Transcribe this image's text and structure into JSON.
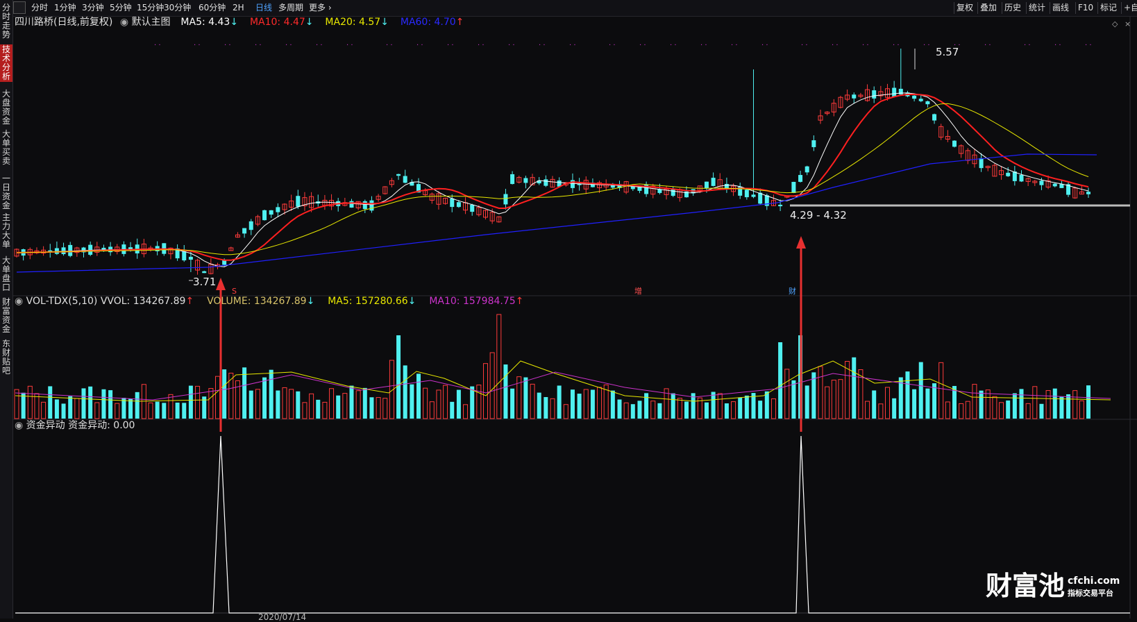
{
  "sidebar": {
    "tabs": [
      {
        "label": "分时走势",
        "active": false
      },
      {
        "label": "技术分析",
        "active": true
      },
      {
        "label": "大盘资金",
        "active": false
      },
      {
        "label": "大单买卖",
        "active": false
      },
      {
        "label": "一日资金",
        "active": false
      },
      {
        "label": "主力大单",
        "active": false
      },
      {
        "label": "大单盘口",
        "active": false
      },
      {
        "label": "财富资金",
        "active": false
      },
      {
        "label": "东财贴吧",
        "active": false
      }
    ]
  },
  "toolbar": {
    "periods": [
      {
        "label": "分时",
        "active": false
      },
      {
        "label": "1分钟",
        "active": false
      },
      {
        "label": "3分钟",
        "active": false
      },
      {
        "label": "5分钟",
        "active": false
      },
      {
        "label": "15分钟",
        "active": false
      },
      {
        "label": "30分钟",
        "active": false
      },
      {
        "label": "60分钟",
        "active": false
      },
      {
        "label": "2H",
        "active": false
      },
      {
        "label": "日线",
        "active": true
      },
      {
        "label": "多周期",
        "active": false
      },
      {
        "label": "更多",
        "active": false
      }
    ],
    "right": [
      "复权",
      "叠加",
      "历史",
      "统计",
      "画线",
      "F10",
      "标记",
      "+自"
    ]
  },
  "main_legend": {
    "stock": "四川路桥(日线,前复权)",
    "indicator": "默认主图",
    "ma5": "MA5: 4.43",
    "ma5_arrow": "↓",
    "ma10": "MA10: 4.47",
    "ma10_arrow": "↓",
    "ma20": "MA20: 4.57",
    "ma20_arrow": "↓",
    "ma60": "MA60: 4.70",
    "ma60_arrow": "↑"
  },
  "vol_legend": {
    "name": "VOL-TDX(5,10)",
    "vvol": "VVOL: 134267.89",
    "vvol_arrow": "↑",
    "volume": "VOLUME: 134267.89",
    "volume_arrow": "↓",
    "ma5": "MA5: 157280.66",
    "ma5_arrow": "↓",
    "ma10": "MA10: 157984.75",
    "ma10_arrow": "↑"
  },
  "fund_legend": {
    "name": "资金异动",
    "value": "资金异动: 0.00"
  },
  "annotations": {
    "high_label": "5.57",
    "low_label": "3.71",
    "range_label": "4.29 - 4.32",
    "marker_s": "S",
    "marker_zeng": "增",
    "marker_cai": "财"
  },
  "date_labels": [
    "2020/07/14"
  ],
  "watermark": {
    "brand": "财富池",
    "domain": "cfchi.com",
    "slogan": "指标交易平台"
  },
  "colors": {
    "up": "#ff3b3b",
    "down": "#4ff0f0",
    "ma5": "#ffffff",
    "ma10": "#ff2020",
    "ma20": "#e8e800",
    "ma60": "#2020ff",
    "vol_ma10": "#cc33cc",
    "arrow": "#e83030"
  },
  "chart_data": {
    "type": "candlestick",
    "title": "四川路桥(日线,前复权)",
    "price_annotations": {
      "high": 5.57,
      "low": 3.71,
      "range_low": 4.29,
      "range_high": 4.32
    },
    "ma_latest": {
      "MA5": 4.43,
      "MA10": 4.47,
      "MA20": 4.57,
      "MA60": 4.7
    },
    "volume_latest": {
      "VVOL": 134267.89,
      "VOLUME": 134267.89,
      "MA5": 157280.66,
      "MA10": 157984.75
    },
    "signal_latest": {
      "资金异动": 0.0
    },
    "signal_spikes": 2
  }
}
